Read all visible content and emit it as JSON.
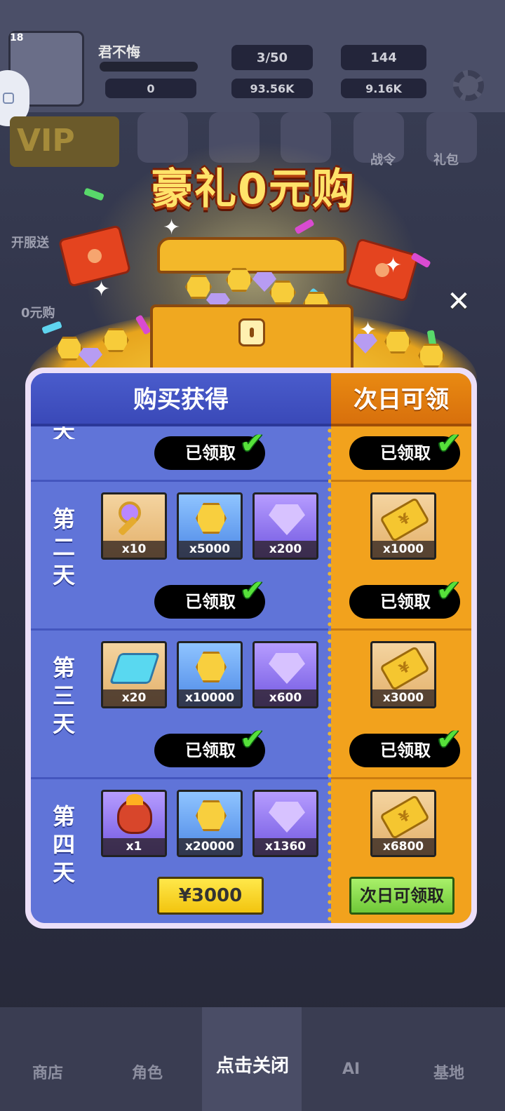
{
  "background": {
    "level": "18",
    "player_name": "君不悔",
    "stat_rows": [
      "3/50",
      "144",
      "0",
      "93.56K",
      "9.16K"
    ],
    "vip_label": "VIP",
    "side_labels": [
      "开服送",
      "0元购",
      "战令",
      "礼包"
    ],
    "bottom_tabs": [
      "商店",
      "角色",
      "AI",
      "基地"
    ]
  },
  "popup": {
    "title": "豪礼0元购",
    "close_icon": "close-x-icon",
    "header_left": "购买获得",
    "header_right": "次日可领",
    "rows": [
      {
        "day_label": "天",
        "left_status": "已领取",
        "right_status": "已领取"
      },
      {
        "day_label": "第二天",
        "items": [
          {
            "icon": "key-icon",
            "count": "x10"
          },
          {
            "icon": "gold-coin-icon",
            "count": "x5000"
          },
          {
            "icon": "gem-icon",
            "count": "x200"
          }
        ],
        "right_item": {
          "icon": "ticket-icon",
          "count": "x1000"
        },
        "left_status": "已领取",
        "right_status": "已领取"
      },
      {
        "day_label": "第三天",
        "items": [
          {
            "icon": "crystal-book-icon",
            "count": "x20"
          },
          {
            "icon": "gold-coin-icon",
            "count": "x10000"
          },
          {
            "icon": "gem-icon",
            "count": "x600"
          }
        ],
        "right_item": {
          "icon": "ticket-icon",
          "count": "x3000"
        },
        "left_status": "已领取",
        "right_status": "已领取"
      },
      {
        "day_label": "第四天",
        "items": [
          {
            "icon": "dragon-pet-icon",
            "count": "x1"
          },
          {
            "icon": "gold-coin-icon",
            "count": "x20000"
          },
          {
            "icon": "gem-icon",
            "count": "x1360"
          }
        ],
        "right_item": {
          "icon": "ticket-icon",
          "count": "x6800"
        },
        "price": "¥3000",
        "next_day_button": "次日可领取"
      }
    ],
    "close_hint": "点击关闭"
  }
}
